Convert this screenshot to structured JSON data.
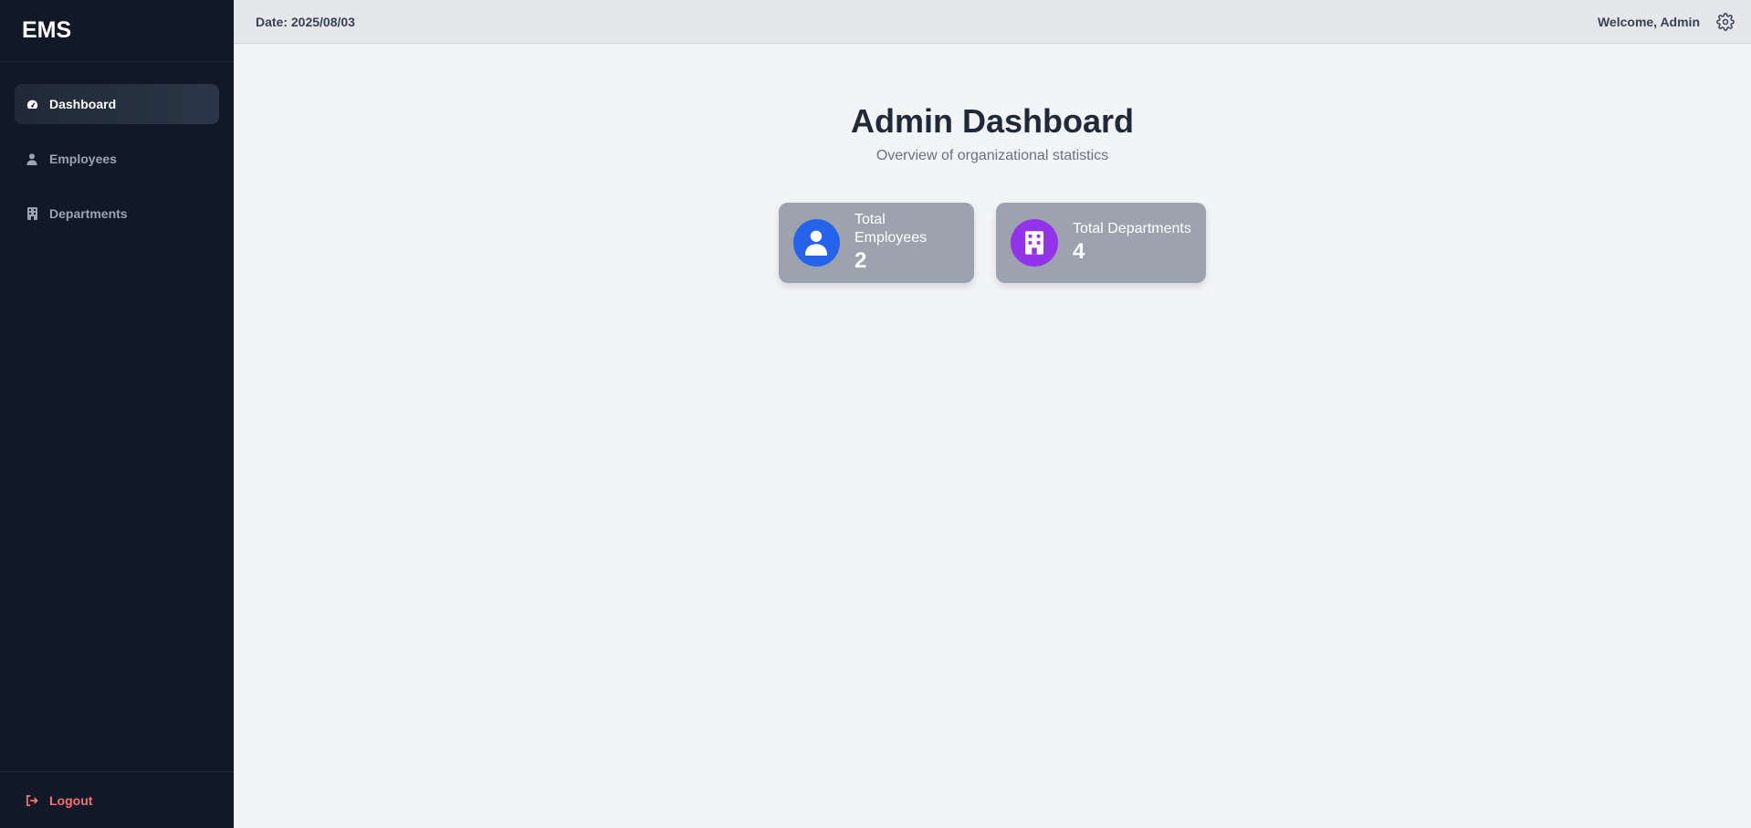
{
  "brand": {
    "name": "EMS"
  },
  "sidebar": {
    "items": [
      {
        "label": "Dashboard",
        "icon": "dashboard-icon",
        "active": true
      },
      {
        "label": "Employees",
        "icon": "user-icon",
        "active": false
      },
      {
        "label": "Departments",
        "icon": "building-icon",
        "active": false
      }
    ],
    "logout_label": "Logout"
  },
  "topbar": {
    "date": "Date: 2025/08/03",
    "welcome": "Welcome, Admin",
    "settings_icon": "gear-icon"
  },
  "main": {
    "title": "Admin Dashboard",
    "subtitle": "Overview of organizational statistics",
    "cards": [
      {
        "label": "Total Employees",
        "value": "2",
        "icon": "user-icon",
        "icon_bg": "#2563eb"
      },
      {
        "label": "Total Departments",
        "value": "4",
        "icon": "building-icon",
        "icon_bg": "#9333ea"
      }
    ]
  },
  "colors": {
    "sidebar_bg": "#111827",
    "logout": "#f87171",
    "card_bg": "#9ca3af",
    "page_bg": "#f3f4f6"
  }
}
